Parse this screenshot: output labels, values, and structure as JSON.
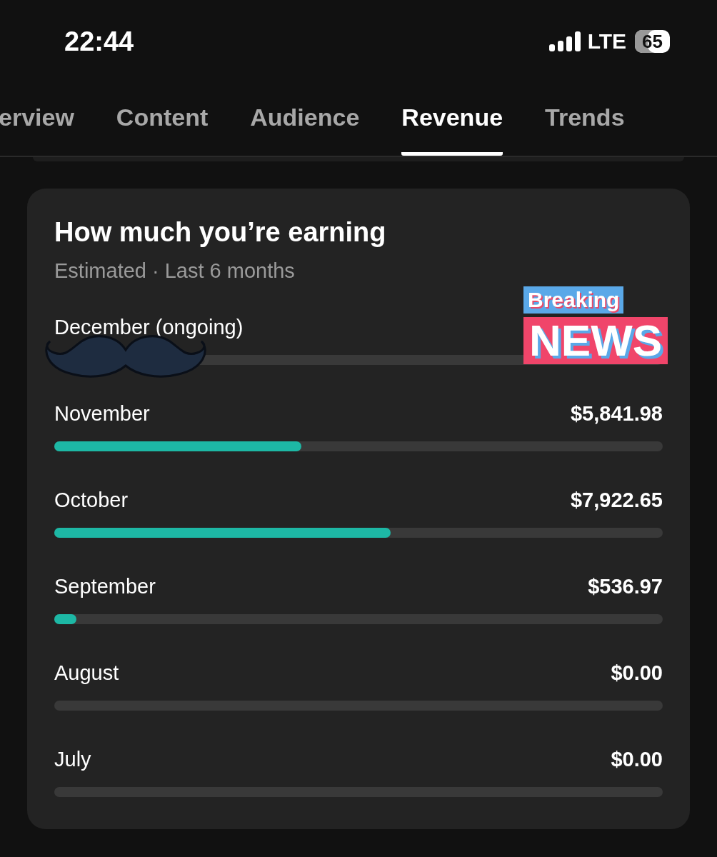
{
  "status_bar": {
    "time": "22:44",
    "network": "LTE",
    "battery": "65"
  },
  "tabs": [
    {
      "label": "erview",
      "selected": false
    },
    {
      "label": "Content",
      "selected": false
    },
    {
      "label": "Audience",
      "selected": false
    },
    {
      "label": "Revenue",
      "selected": true
    },
    {
      "label": "Trends",
      "selected": false
    }
  ],
  "card": {
    "title": "How much you’re earning",
    "subtitle": "Estimated · Last 6 months",
    "rows": [
      {
        "month": "December (ongoing)"
      },
      {
        "month": "November",
        "amount": "$5,841.98",
        "level": 0.406
      },
      {
        "month": "October",
        "amount": "$7,922.65",
        "level": 0.553
      },
      {
        "month": "September",
        "amount": "$536.97",
        "level": 0.036
      },
      {
        "month": "August",
        "amount": "$0.00"
      },
      {
        "month": "July",
        "amount": "$0.00"
      }
    ]
  },
  "sticker": {
    "top": "Breaking",
    "bottom": "NEWS"
  }
}
